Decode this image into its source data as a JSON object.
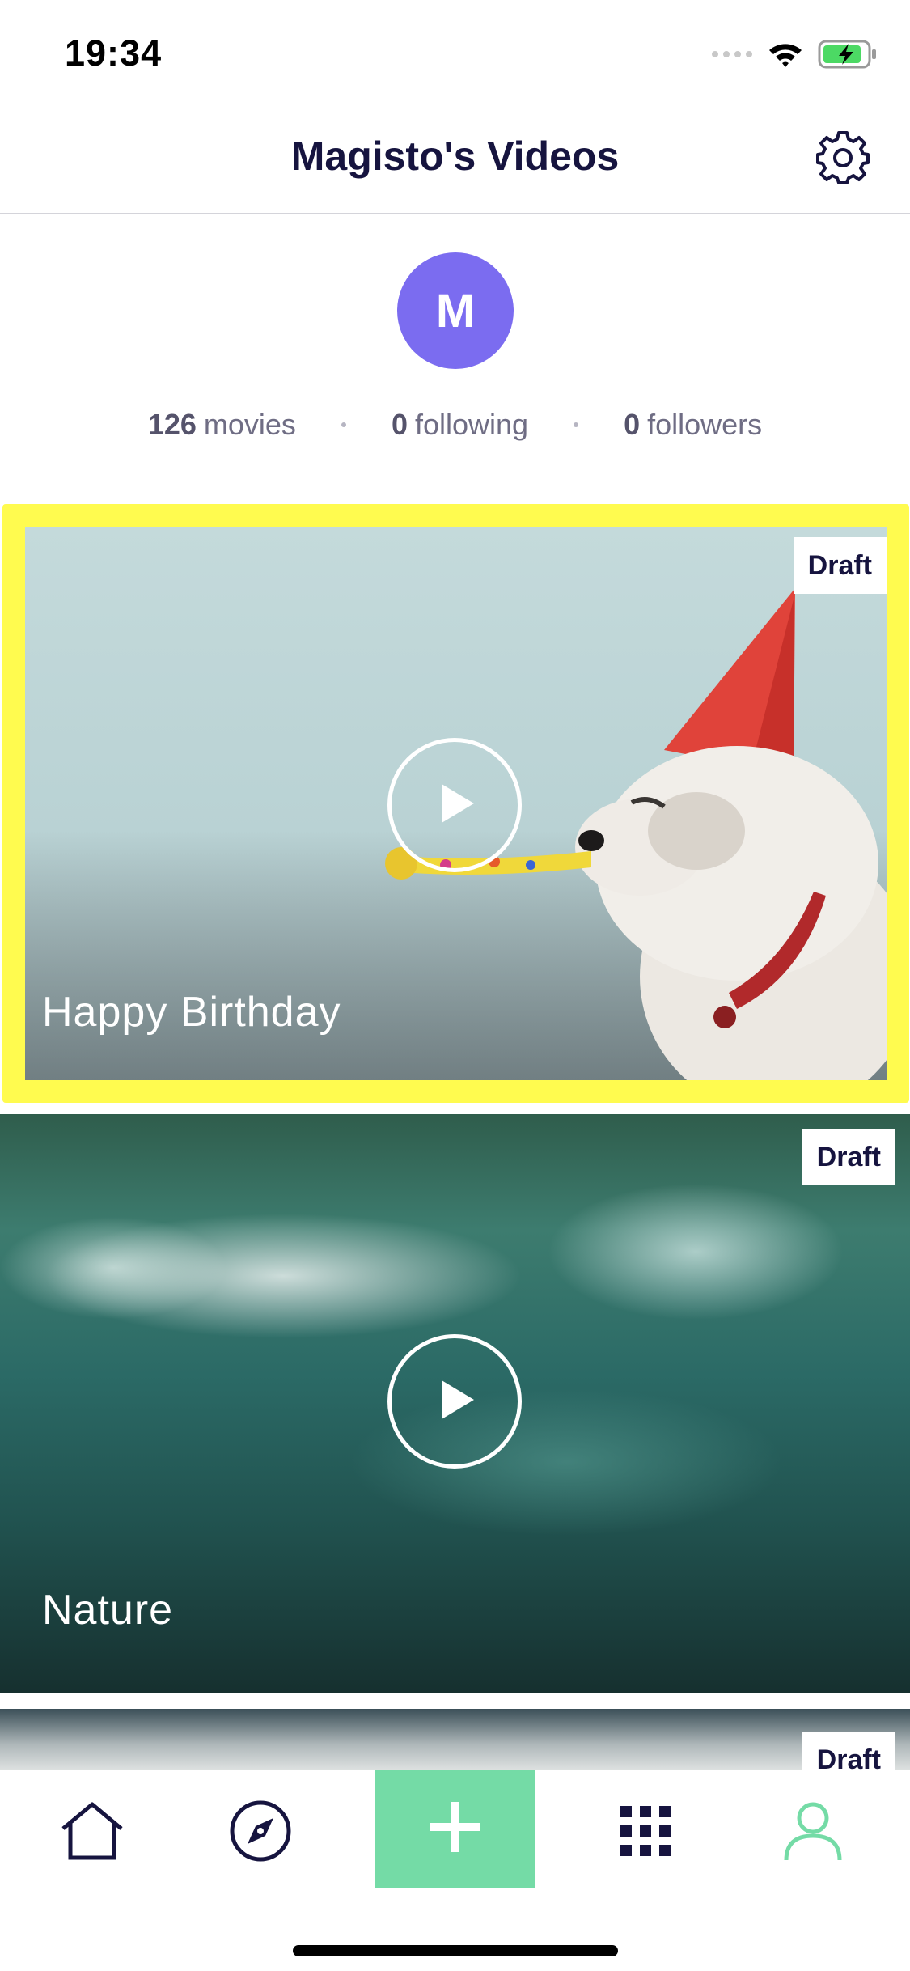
{
  "status_bar": {
    "time": "19:34",
    "icons": [
      "signal-icon",
      "wifi-icon",
      "battery-charging-icon"
    ]
  },
  "header": {
    "title": "Magisto's Videos",
    "settings_icon": "gear-icon"
  },
  "profile": {
    "avatar_letter": "M",
    "avatar_color": "#7b6cf0",
    "stats": [
      {
        "count": "126",
        "label": "movies"
      },
      {
        "count": "0",
        "label": "following"
      },
      {
        "count": "0",
        "label": "followers"
      }
    ]
  },
  "videos": [
    {
      "title": "Happy Birthday",
      "badge": "Draft",
      "highlighted": true
    },
    {
      "title": "Nature",
      "badge": "Draft"
    },
    {
      "title": "",
      "badge": "Draft"
    }
  ],
  "bottom_nav": {
    "items": [
      "home-icon",
      "compass-icon",
      "plus-icon",
      "grid-icon",
      "profile-icon"
    ],
    "accent_color": "#74dba6",
    "active": "profile-icon"
  },
  "colors": {
    "highlight": "#fffb4f",
    "text_dark": "#16143f"
  }
}
